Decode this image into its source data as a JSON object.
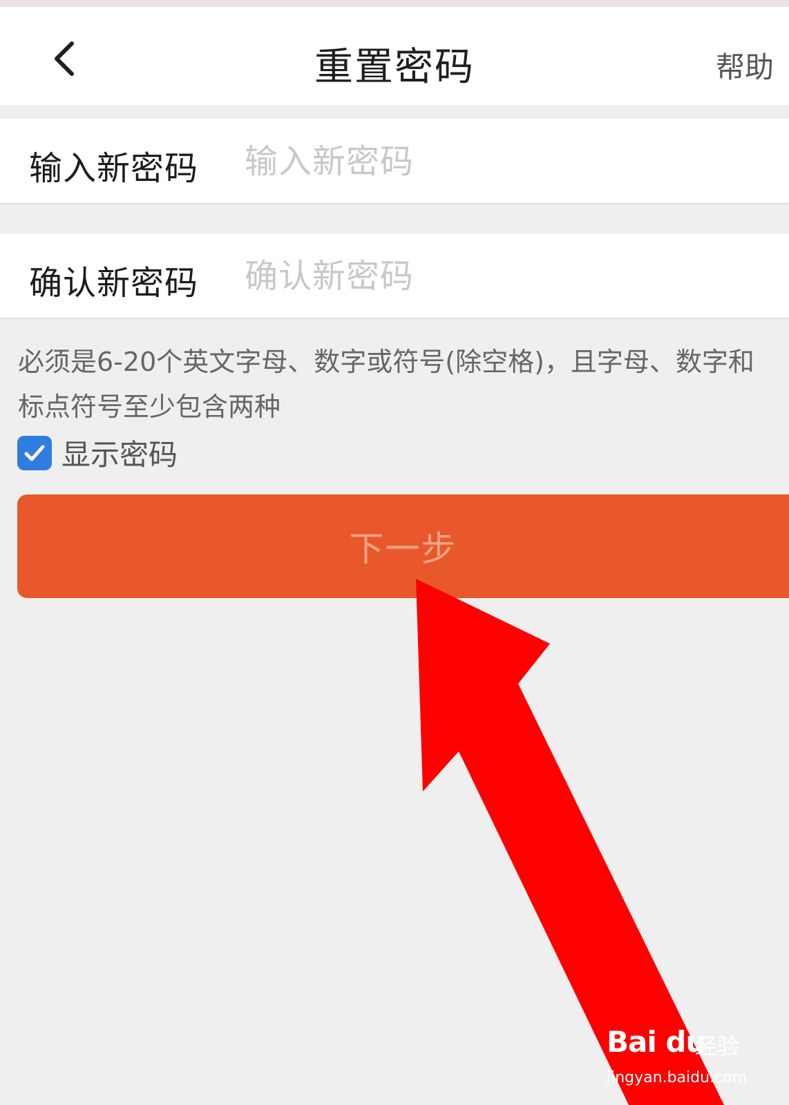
{
  "header": {
    "title": "重置密码",
    "help_label": "帮助"
  },
  "form": {
    "new_password": {
      "label": "输入新密码",
      "placeholder": "输入新密码",
      "value": ""
    },
    "confirm_password": {
      "label": "确认新密码",
      "placeholder": "确认新密码",
      "value": ""
    },
    "hint": "必须是6-20个英文字母、数字或符号(除空格)，且字母、数字和标点符号至少包含两种",
    "show_password": {
      "label": "显示密码",
      "checked": true
    },
    "next_label": "下一步"
  },
  "watermark": {
    "brand": "Bai du",
    "sub": "经验",
    "url": "jingyan.baidu.com"
  },
  "colors": {
    "accent": "#e8582b",
    "checkbox": "#2f7de1",
    "annotation_arrow": "#ff0000"
  },
  "icons": {
    "back": "chevron-left-icon",
    "checkbox": "checkmark-icon"
  }
}
